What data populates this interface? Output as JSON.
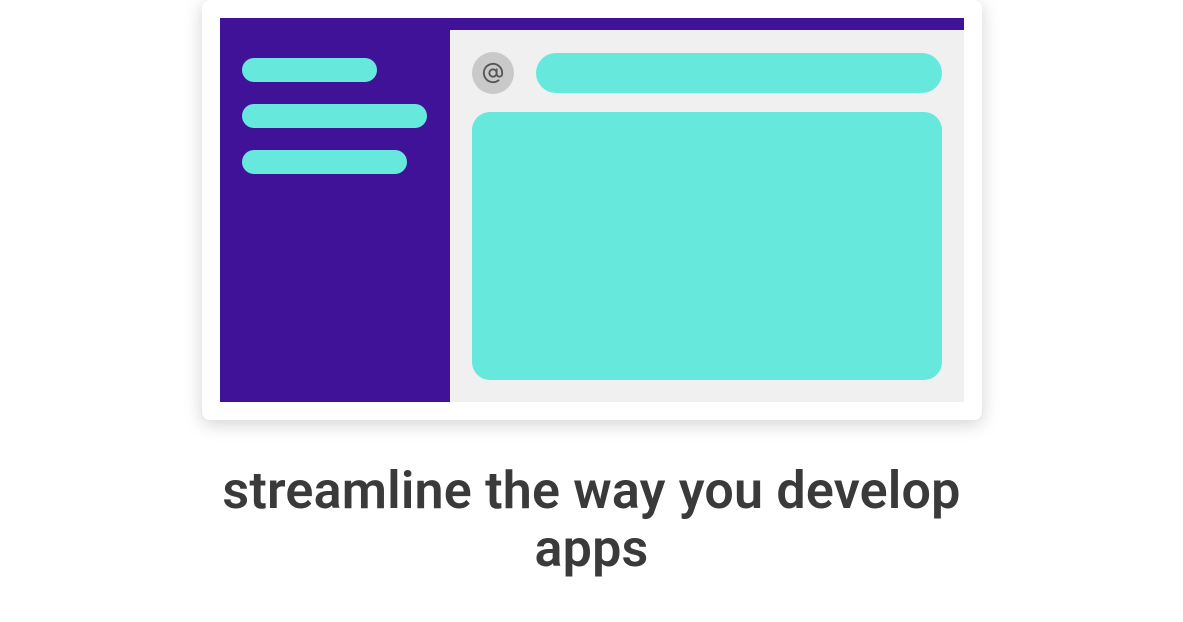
{
  "headline": "streamline the way you develop apps",
  "mockup": {
    "sidebar_items": [
      "",
      "",
      ""
    ],
    "avatar_icon": "at-sign-icon",
    "colors": {
      "brand_purple": "#3f1298",
      "brand_teal": "#67e8dd",
      "panel_grey": "#f0f0f0",
      "text_color": "#3a3a3a"
    }
  }
}
